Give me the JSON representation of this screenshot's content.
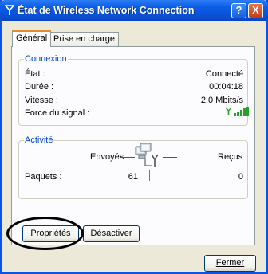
{
  "window": {
    "title": "État de Wireless Network Connection",
    "help_label": "?",
    "close_label": "X"
  },
  "tabs": [
    {
      "label": "Général"
    },
    {
      "label": "Prise en charge"
    }
  ],
  "connection": {
    "legend": "Connexion",
    "rows": [
      {
        "label": "État :",
        "value": "Connecté"
      },
      {
        "label": "Durée :",
        "value": "00:04:18"
      },
      {
        "label": "Vitesse :",
        "value": "2,0 Mbits/s"
      },
      {
        "label": "Force du signal :",
        "value": ""
      }
    ],
    "signal_bars": 5
  },
  "activity": {
    "legend": "Activité",
    "sent_label": "Envoyés",
    "recv_label": "Reçus",
    "packets_label": "Paquets :",
    "packets_sent": "61",
    "packets_recv": "0"
  },
  "buttons": {
    "properties": "Propriétés",
    "disable": "Désactiver",
    "close": "Fermer"
  },
  "colors": {
    "titlebar": "#0a55e6",
    "legend": "#0046d5",
    "signal": "#2ca02c",
    "tab_accent": "#e68b2c"
  }
}
